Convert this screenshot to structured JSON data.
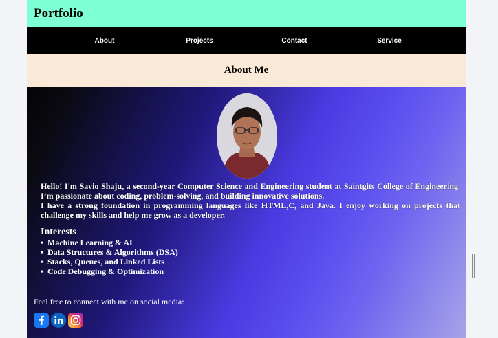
{
  "header": {
    "brand": "Portfolio"
  },
  "nav": {
    "items": [
      "About",
      "Projects",
      "Contact",
      "Service"
    ]
  },
  "section": {
    "title": "About Me"
  },
  "bio": {
    "paragraph1": "Hello! I'm Savio Shaju, a second-year Computer Science and Engineering student at Saintgits College of Engineering. I’m passionate about coding, problem-solving, and building innovative solutions.",
    "paragraph2": "I have a strong foundation in programming languages like HTML,C, and Java. I enjoy working on projects that challenge my skills and help me grow as a developer."
  },
  "interests": {
    "title": "Interests",
    "items": [
      "Machine Learning & AI",
      "Data Structures & Algorithms (DSA)",
      "Stacks, Queues, and Linked Lists",
      "Code Debugging & Optimization"
    ]
  },
  "connect": {
    "text": "Feel free to connect with me on social media:"
  },
  "socials": {
    "icons": [
      "facebook-icon",
      "linkedin-icon",
      "instagram-icon"
    ]
  },
  "colors": {
    "header_bg": "#7fffd4",
    "nav_bg": "#000000",
    "section_head_bg": "#fbe9d7",
    "hero_gradient_mid": "#5b4ff0"
  }
}
